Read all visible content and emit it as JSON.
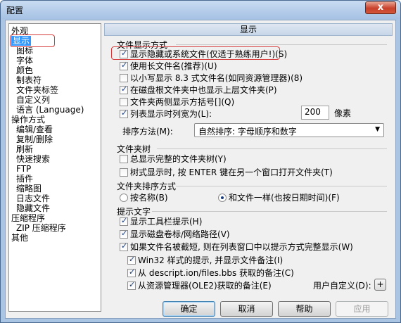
{
  "window": {
    "title": "配置",
    "close_symbol": "x"
  },
  "tree": {
    "items": [
      {
        "label": "外观",
        "indent": 0
      },
      {
        "label": "显示",
        "indent": 0,
        "selected": true
      },
      {
        "label": "图标",
        "indent": 1
      },
      {
        "label": "字体",
        "indent": 1
      },
      {
        "label": "颜色",
        "indent": 1
      },
      {
        "label": "制表符",
        "indent": 1
      },
      {
        "label": "文件夹标签",
        "indent": 1
      },
      {
        "label": "自定义列",
        "indent": 1
      },
      {
        "label": "语言 (Language)",
        "indent": 1
      },
      {
        "label": "操作方式",
        "indent": 0
      },
      {
        "label": "编辑/查看",
        "indent": 1
      },
      {
        "label": "复制/删除",
        "indent": 1
      },
      {
        "label": "刷新",
        "indent": 1
      },
      {
        "label": "快速搜索",
        "indent": 1
      },
      {
        "label": "FTP",
        "indent": 1
      },
      {
        "label": "插件",
        "indent": 1
      },
      {
        "label": "缩略图",
        "indent": 1
      },
      {
        "label": "日志文件",
        "indent": 1
      },
      {
        "label": "隐藏文件",
        "indent": 1
      },
      {
        "label": "压缩程序",
        "indent": 0
      },
      {
        "label": "ZIP 压缩程序",
        "indent": 1
      },
      {
        "label": "其他",
        "indent": 0
      }
    ]
  },
  "panel": {
    "header": "显示",
    "file_display": {
      "label": "文件显示方式",
      "options": [
        {
          "label": "显示隐藏或系统文件(仅适于熟练用户!)(S)",
          "checked": true
        },
        {
          "label": "使用长文件名(推荐)(U)",
          "checked": true
        },
        {
          "label": "以小写显示 8.3 式文件名(如同资源管理器)(8)",
          "checked": false
        },
        {
          "label": "在磁盘根文件夹中也显示上层文件夹(P)",
          "checked": true
        },
        {
          "label": "文件夹两侧显示方括号[](Q)",
          "checked": false
        },
        {
          "label": "列表显示时列宽为(L):",
          "checked": true
        }
      ],
      "column_width": "200",
      "column_width_unit": "像素",
      "sort_label": "排序方法(M):",
      "sort_value": "自然排序: 字母顺序和数字"
    },
    "folder_tree": {
      "label": "文件夹树",
      "options": [
        {
          "label": "总显示完整的文件夹树(Y)",
          "checked": false
        },
        {
          "label": "树式显示时, 按 ENTER 键在另一个窗口打开文件夹(T)",
          "checked": false
        }
      ]
    },
    "folder_sort": {
      "label": "文件夹排序方式",
      "options": [
        {
          "label": "按名称(B)",
          "checked": false
        },
        {
          "label": "和文件一样(也按日期时间)(F)",
          "checked": true
        }
      ]
    },
    "tooltips": {
      "label": "提示文字",
      "options": [
        {
          "label": "显示工具栏提示(H)",
          "checked": true
        },
        {
          "label": "显示磁盘卷标/网络路径(V)",
          "checked": true
        },
        {
          "label": "如果文件名被截短, 则在列表窗口中以提示方式完整显示(W)",
          "checked": true
        },
        {
          "label": "Win32 样式的提示, 并显示文件备注(I)",
          "checked": true
        },
        {
          "label": "从 descript.ion/files.bbs 获取的备注(C)",
          "checked": true
        },
        {
          "label": "从资源管理器(OLE2)获取的备注(E)",
          "checked": true
        }
      ],
      "custom_label": "用户自定义(D):",
      "custom_button": "+"
    }
  },
  "buttons": {
    "ok": "确定",
    "cancel": "取消",
    "help": "帮助",
    "apply": "应用"
  }
}
